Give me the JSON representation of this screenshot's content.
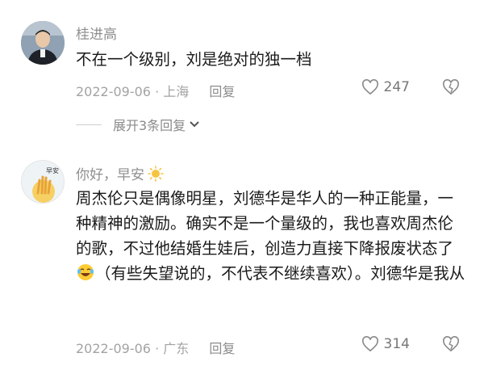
{
  "comments": [
    {
      "username": "桂进高",
      "text": "不在一个级别，刘是绝对的独一档",
      "date": "2022-09-06",
      "location": "上海",
      "reply_label": "回复",
      "likes": "247",
      "expand_label": "展开3条回复"
    },
    {
      "username": "你好，早安",
      "text_before_emoji": "周杰伦只是偶像明星，刘德华是华人的一种正能量，一种精神的激励。确实不是一个量级的，我也喜欢周杰伦的歌，不过他结婚生娃后，创造力直接下降报废状态了",
      "text_after_emoji": "（有些失望说的，不代表不继续喜欢）。刘德华是我从",
      "date": "2022-09-06",
      "location": "广东",
      "reply_label": "回复",
      "likes": "314",
      "avatar_text": "早安"
    }
  ]
}
